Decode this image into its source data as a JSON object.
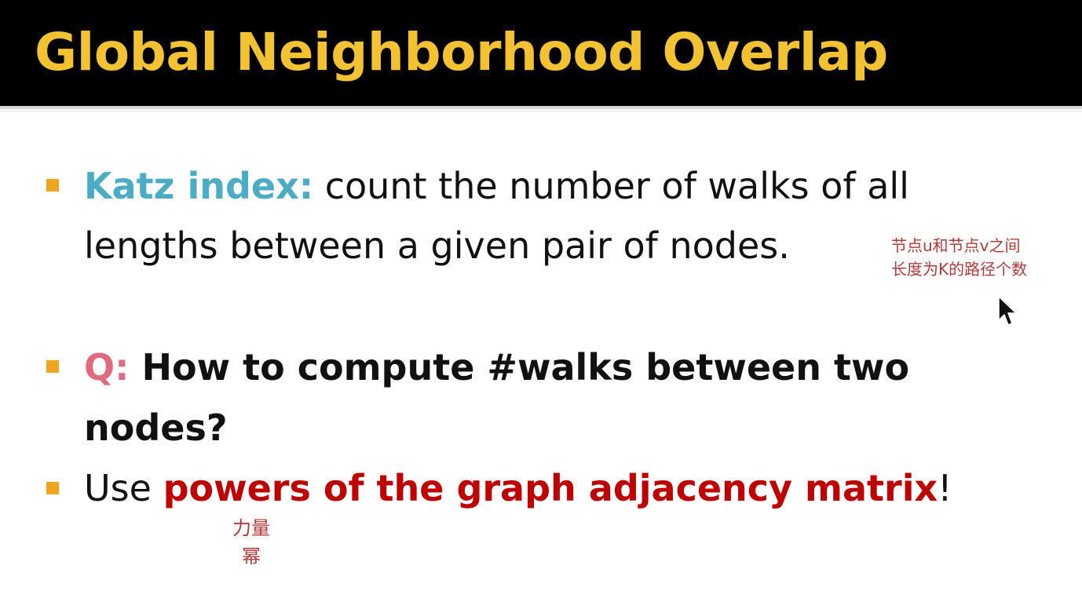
{
  "slide": {
    "title": "Global Neighborhood Overlap",
    "bullets": [
      {
        "term": "Katz index:",
        "line1_rest": " count the number of walks of all",
        "line2": "lengths between a given pair of nodes."
      },
      {
        "term": "Q:",
        "line1_rest": " How to compute #walks between two",
        "line2": "nodes?"
      },
      {
        "prefix": "Use ",
        "highlight": "powers of the graph adjacency matrix",
        "suffix": "!"
      }
    ],
    "annotations": {
      "walks_note_line1": "节点u和节点v之间",
      "walks_note_line2": "长度为K的路径个数",
      "powers_note_line1": "力量",
      "powers_note_line2": "幂"
    }
  },
  "colors": {
    "title_bar": "#000000",
    "title_text": "#f2c230",
    "bullet": "#f0a51f",
    "term_katz": "#4bacc6",
    "term_q": "#e06b7f",
    "highlight": "#c00000",
    "annotation": "#b43a3a"
  },
  "icons": {
    "bullet": "square-bullet-icon",
    "cursor": "mouse-pointer-icon"
  }
}
